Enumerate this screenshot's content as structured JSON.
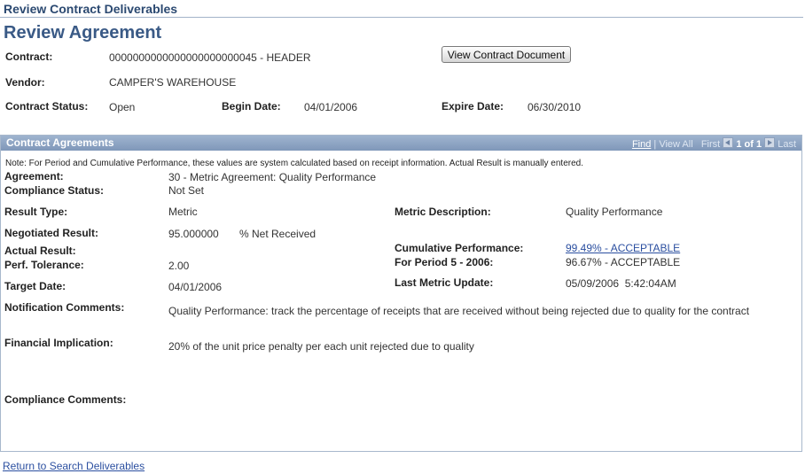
{
  "page": {
    "header": "Review Contract Deliverables",
    "title": "Review Agreement"
  },
  "contract": {
    "contract_label": "Contract:",
    "contract_value": "0000000000000000000000045 - HEADER",
    "view_button": "View Contract Document",
    "vendor_label": "Vendor:",
    "vendor_value": "CAMPER'S WAREHOUSE",
    "status_label": "Contract Status:",
    "status_value": "Open",
    "begin_label": "Begin Date:",
    "begin_value": "04/01/2006",
    "expire_label": "Expire Date:",
    "expire_value": "06/30/2010"
  },
  "grid": {
    "title": "Contract Agreements",
    "nav": {
      "find": "Find",
      "view_all": "View All",
      "first": "First",
      "range": "1 of 1",
      "last": "Last"
    },
    "note": "Note: For Period and Cumulative Performance, these values are system calculated based on receipt information.  Actual Result is manually entered.",
    "agreement_label": "Agreement:",
    "agreement_value": "30 - Metric Agreement: Quality Performance",
    "compliance_status_label": "Compliance Status:",
    "compliance_status_value": "Not Set",
    "result_type_label": "Result Type:",
    "result_type_value": "Metric",
    "metric_desc_label": "Metric Description:",
    "metric_desc_value": "Quality Performance",
    "negotiated_label": "Negotiated Result:",
    "negotiated_value": "95.000000",
    "negotiated_unit": "% Net Received",
    "actual_label": "Actual Result:",
    "cumulative_label": "Cumulative Performance:",
    "cumulative_value": "99.49% - ACCEPTABLE",
    "tolerance_label": "Perf. Tolerance:",
    "tolerance_value": "2.00",
    "period_label": "For Period 5 - 2006:",
    "period_value": "96.67% - ACCEPTABLE",
    "target_label": "Target Date:",
    "target_value": "04/01/2006",
    "last_update_label": "Last Metric Update:",
    "last_update_value": "05/09/2006  5:42:04AM",
    "notification_label": "Notification Comments:",
    "notification_value": "Quality Performance: track the percentage of receipts that are received without being rejected due to quality for the contract",
    "financial_label": "Financial Implication:",
    "financial_value": "20% of the unit price penalty per each unit rejected due to quality",
    "compliance_comments_label": "Compliance Comments:"
  },
  "footer": {
    "return_link": "Return to Search Deliverables"
  },
  "colors": {
    "title": "#3a5a86",
    "grid_bar": "#8ca3c4",
    "link": "#2b4fa0"
  }
}
